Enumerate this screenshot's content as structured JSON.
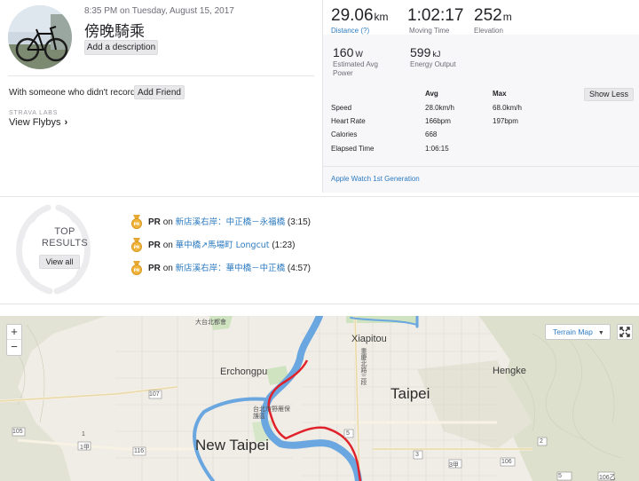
{
  "activity": {
    "datetime": "8:35 PM on Tuesday, August 15, 2017",
    "title": "傍晚騎乘",
    "add_description_label": "Add a description",
    "with_someone_text": "With someone who didn't record?",
    "add_friend_label": "Add Friend",
    "labs_label": "STRAVA LABS",
    "flybys_label": "View Flybys",
    "flybys_chevron": "›"
  },
  "stats": {
    "distance": {
      "value": "29.06",
      "unit": "km",
      "label": "Distance (?)"
    },
    "moving_time": {
      "value": "1:02:17",
      "label": "Moving Time"
    },
    "elevation": {
      "value": "252",
      "unit": "m",
      "label": "Elevation"
    },
    "power": {
      "value": "160",
      "unit": "W",
      "label_line1": "Estimated Avg",
      "label_line2": "Power"
    },
    "energy": {
      "value": "599",
      "unit": "kJ",
      "label": "Energy Output"
    },
    "table": {
      "col_avg": "Avg",
      "col_max": "Max",
      "show_less_label": "Show Less",
      "rows": [
        {
          "label": "Speed",
          "avg": "28.0km/h",
          "max": "68.0km/h"
        },
        {
          "label": "Heart Rate",
          "avg": "166bpm",
          "max": "197bpm"
        },
        {
          "label": "Calories",
          "avg": "668",
          "max": ""
        },
        {
          "label": "Elapsed Time",
          "avg": "1:06:15",
          "max": ""
        }
      ]
    },
    "device": "Apple Watch 1st Generation"
  },
  "top_results": {
    "title_line1": "TOP",
    "title_line2": "RESULTS",
    "view_all_label": "View all",
    "items": [
      {
        "badge": "PR",
        "on": "on",
        "segment": "新店溪右岸：中正橋－永福橋",
        "time": "(3:15)"
      },
      {
        "badge": "PR",
        "on": "on",
        "segment": "華中橋↗馬場町 Longcut",
        "time": "(1:23)"
      },
      {
        "badge": "PR",
        "on": "on",
        "segment": "新店溪右岸：華中橋－中正橋",
        "time": "(4:57)"
      }
    ]
  },
  "map": {
    "zoom_in": "+",
    "zoom_out": "−",
    "map_type_label": "Terrain Map",
    "map_type_caret": "▼",
    "labels": {
      "xiapitou": "Xiapitou",
      "hengke": "Hengke",
      "erchongpu": "Erchongpu",
      "taipei": "Taipei",
      "new_taipei": "New Taipei",
      "district_top": "大台北都會",
      "district_taipei": "台北市野雁保護區",
      "chongqing_road": "重慶北路三段",
      "road_107": "107",
      "road_105": "105",
      "road_1": "1",
      "road_1a": "1甲",
      "road_116": "116",
      "road_5": "5",
      "road_3a": "3甲",
      "road_106": "106",
      "road_106b": "106乙",
      "road_3": "3",
      "road_2": "2",
      "road_5b": "5"
    }
  },
  "colors": {
    "link": "#2d7bc1",
    "route": "#e0222a",
    "river": "#6aa6e0",
    "medal": "#f0b43a"
  }
}
